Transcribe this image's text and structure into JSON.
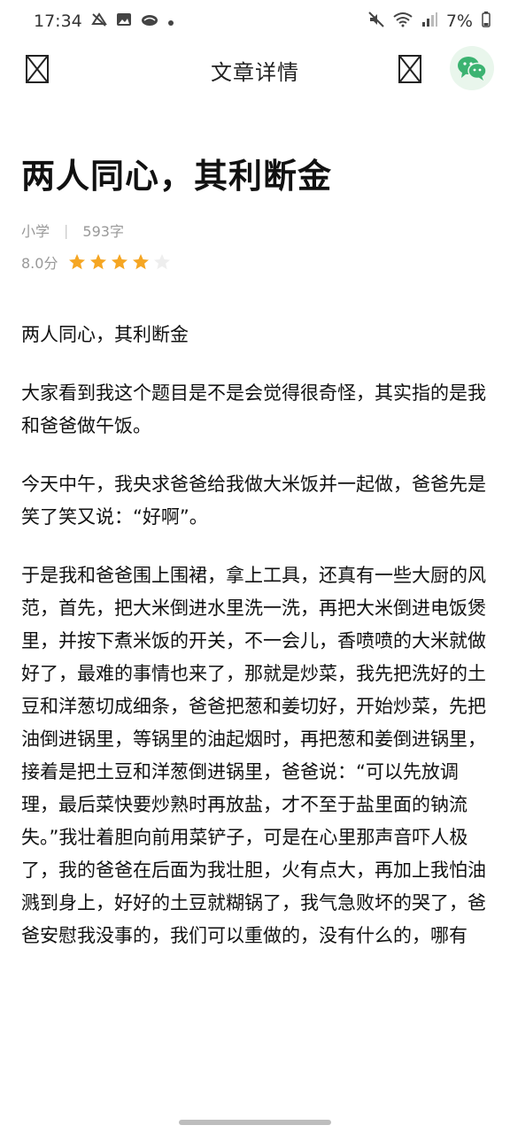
{
  "status_bar": {
    "time": "17:34",
    "battery": "7%",
    "left_icons": [
      "notification-icon",
      "image-icon",
      "cloud-icon",
      "dot-icon"
    ],
    "right_icons": [
      "mute-icon",
      "wifi-icon",
      "signal-icon",
      "battery-icon"
    ]
  },
  "header": {
    "title": "文章详情",
    "left_icon": "placeholder-box-icon",
    "right_icon": "placeholder-box-icon",
    "share_icon": "wechat-icon",
    "share_color": "#3cb371"
  },
  "article": {
    "title": "两人同心，其利断金",
    "grade": "小学",
    "separator": "|",
    "word_count": "593字",
    "score": "8.0分",
    "stars_filled": 4,
    "stars_total": 5,
    "star_color": "#f5a623",
    "paragraphs": [
      "两人同心，其利断金",
      "大家看到我这个题目是不是会觉得很奇怪，其实指的是我和爸爸做午饭。",
      "今天中午，我央求爸爸给我做大米饭并一起做，爸爸先是笑了笑又说：“好啊”。",
      "于是我和爸爸围上围裙，拿上工具，还真有一些大厨的风范，首先，把大米倒进水里洗一洗，再把大米倒进电饭煲里，并按下煮米饭的开关，不一会儿，香喷喷的大米就做好了，最难的事情也来了，那就是炒菜，我先把洗好的土豆和洋葱切成细条，爸爸把葱和姜切好，开始炒菜，先把油倒进锅里，等锅里的油起烟时，再把葱和姜倒进锅里，接着是把土豆和洋葱倒进锅里，爸爸说：“可以先放调理，最后菜快要炒熟时再放盐，才不至于盐里面的钠流失。”我壮着胆向前用菜铲子，可是在心里那声音吓人极了，我的爸爸在后面为我壮胆，火有点大，再加上我怕油溅到身上，好好的土豆就糊锅了，我气急败坏的哭了，爸爸安慰我没事的，我们可以重做的，没有什么的，哪有"
    ]
  }
}
